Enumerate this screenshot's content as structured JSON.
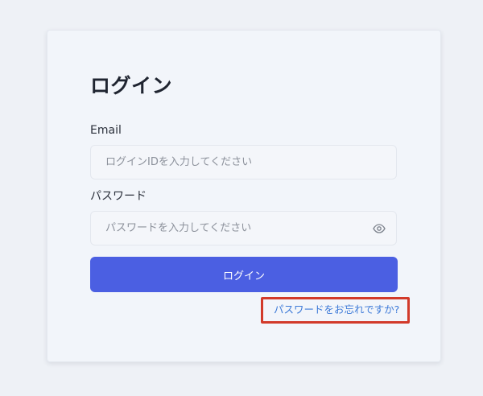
{
  "login": {
    "title": "ログイン",
    "email_label": "Email",
    "email_placeholder": "ログインIDを入力してください",
    "email_value": "",
    "password_label": "パスワード",
    "password_placeholder": "パスワードを入力してください",
    "password_value": "",
    "submit_label": "ログイン",
    "forgot_link": "パスワードをお忘れですか?",
    "show_password_icon": "eye-icon"
  },
  "colors": {
    "page_background": "#eef1f6",
    "card_background": "#f2f5fa",
    "primary_button": "#4b5fe2",
    "link": "#3f7bd8",
    "highlight_border": "#d23a2a"
  }
}
